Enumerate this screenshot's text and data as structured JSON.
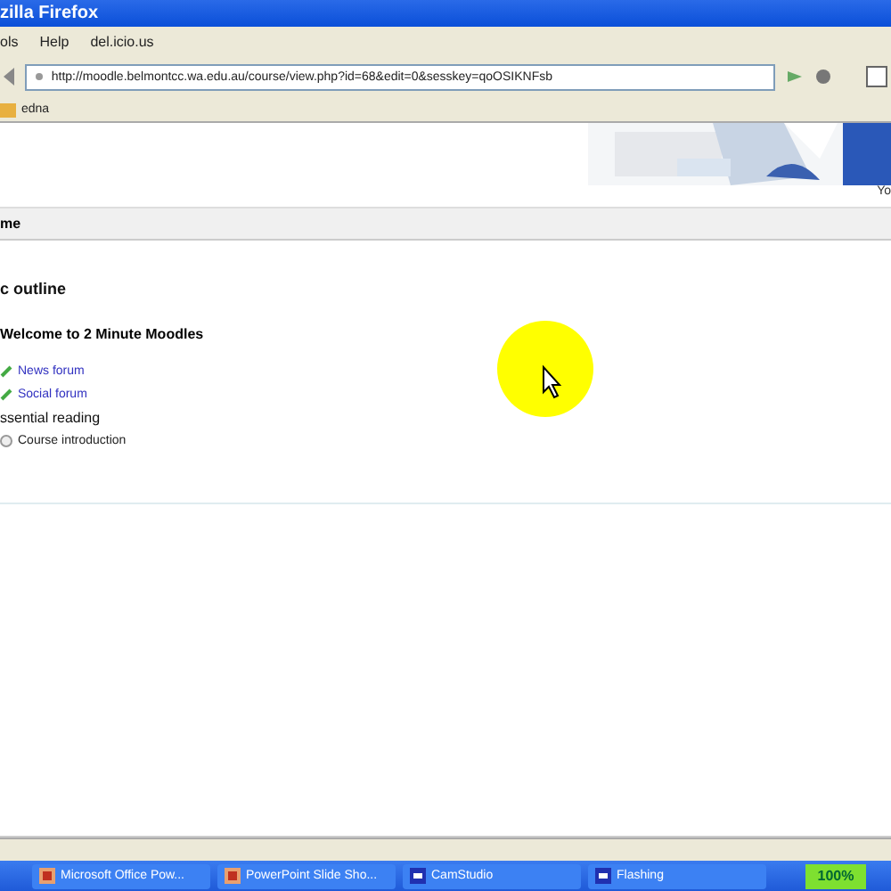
{
  "window": {
    "title": "zilla Firefox"
  },
  "menu": [
    "ols",
    "Help",
    "del.icio.us"
  ],
  "address": {
    "value": "http://moodle.belmontcc.wa.edu.au/course/view.php?id=68&edit=0&sesskey=qoOSIKNFsb"
  },
  "bookmarks": [
    "edna"
  ],
  "header": {
    "login_text": "Yo"
  },
  "breadcrumb": "me",
  "outline": {
    "title": "c outline",
    "section_title": "Welcome to 2 Minute Moodles",
    "items": [
      {
        "kind": "forum",
        "label": "News forum"
      },
      {
        "kind": "forum",
        "label": "Social forum"
      },
      {
        "kind": "heading",
        "label": "ssential reading"
      },
      {
        "kind": "resource",
        "label": "Course introduction"
      }
    ]
  },
  "taskbar": {
    "tasks": [
      {
        "label": "Microsoft Office Pow...",
        "kind": "office"
      },
      {
        "label": "PowerPoint Slide Sho...",
        "kind": "office"
      },
      {
        "label": "CamStudio",
        "kind": "cam"
      },
      {
        "label": "Flashing",
        "kind": "cam"
      }
    ],
    "zoom": "100%"
  }
}
